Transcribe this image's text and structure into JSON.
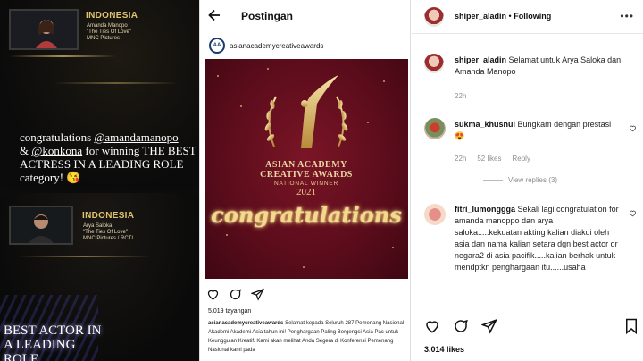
{
  "left": {
    "story1": {
      "country": "INDONESIA",
      "nominee_lines": "Amanda Manopo\n\"The Ties Of Love\"\nMNC Pictures",
      "caption_prefix": "congratulations",
      "mention1": "@amandamanopo",
      "caption_mid": "&",
      "mention2": "@konkona",
      "caption_suffix": "for winning THE BEST ACTRESS IN A LEADING ROLE category! 😘"
    },
    "story2": {
      "country": "INDONESIA",
      "nominee_lines": "Arya Saloka\n\"The Ties Of Love\"\nMNC Pictures / RCTI",
      "title": "BEST ACTOR IN A LEADING ROLE"
    }
  },
  "middle": {
    "back_icon": "arrow-left-icon",
    "title": "Postingan",
    "account": "asianacademycreativeawards",
    "image": {
      "line1": "ASIAN ACADEMY",
      "line2": "CREATIVE AWARDS",
      "line3": "NATIONAL WINNER",
      "year": "2021",
      "script": "congratulations"
    },
    "views": "5.019 tayangan",
    "caption_user": "asianacademycreativeawards",
    "caption_text": "Selamat kepada Seluruh 287 Pemenang Nasional Akademi Akademi Asia tahun ini! Penghargaan Paling Bergengsi Asia Pac untuk Keunggulan Kreatif. Kami akan melihat Anda Segera di Konferensi Pemenang Nasional kami pada"
  },
  "right": {
    "header": {
      "username": "shiper_aladin",
      "separator": "•",
      "follow": "Following"
    },
    "comments": [
      {
        "user": "shiper_aladin",
        "text": "Selamat untuk Arya Saloka dan Amanda Manopo",
        "time": "22h"
      },
      {
        "user": "sukma_khusnul",
        "text": "Bungkam dengan prestasi😍",
        "time": "22h",
        "likes": "52 likes",
        "reply": "Reply",
        "view_replies": "View replies (3)"
      },
      {
        "user": "fitri_lumonggga",
        "text": "Sekali lagi congratulation for amanda manoppo dan arya saloka.....kekuatan akting kalian diakui oleh asia dan nama kalian setara dgn best actor dr negara2 di asia pacifik.....kalian berhak untuk mendptkn penghargaan itu......usaha"
      }
    ],
    "likes": "3.014 likes"
  },
  "colors": {
    "award_bg": "#6b1122",
    "gold": "#ecd9a3",
    "dark_bg": "#0c0c0c"
  }
}
